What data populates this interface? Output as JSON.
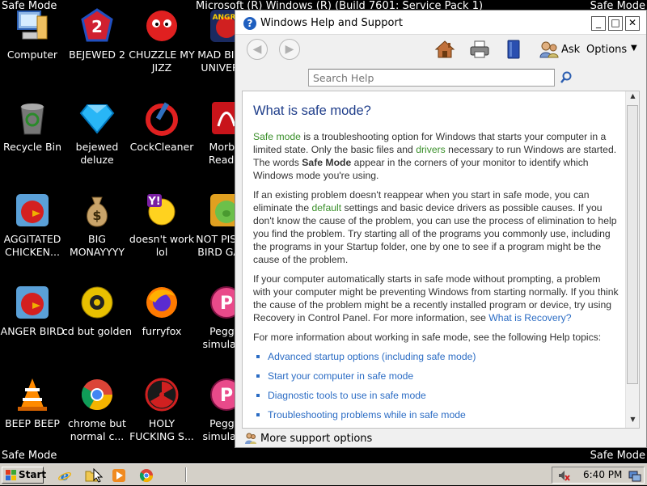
{
  "screen": {
    "mode_label_tl": "Safe Mode",
    "mode_label_tr": "Safe Mode",
    "mode_label_bl": "Safe Mode",
    "mode_label_br": "Safe Mode",
    "os_title": "Microsoft (R) Windows (R) (Build 7601: Service Pack 1)"
  },
  "desktop_icons": [
    {
      "label": "Computer",
      "icon": "computer-icon"
    },
    {
      "label": "BEJEWED 2",
      "icon": "bejewed2-icon"
    },
    {
      "label": "CHUZZLE MY JIZZ",
      "icon": "chuzzle-icon"
    },
    {
      "label": "MAD BIRDS UNIVERSE",
      "icon": "angry-birds-icon"
    },
    {
      "label": "Recycle Bin",
      "icon": "recycle-bin-icon"
    },
    {
      "label": "bejewed deluze",
      "icon": "diamond-icon"
    },
    {
      "label": "CockCleaner",
      "icon": "ccleaner-icon"
    },
    {
      "label": "Morbid Reader",
      "icon": "pdf-reader-icon"
    },
    {
      "label": "AGGITATED CHICKEN...",
      "icon": "angry-bird-red-icon"
    },
    {
      "label": "BIG MONAYYYY",
      "icon": "money-bag-icon"
    },
    {
      "label": "doesn't work lol",
      "icon": "yahoo-messenger-icon"
    },
    {
      "label": "NOT PISSED BIRD GAME",
      "icon": "pig-icon"
    },
    {
      "label": "ANGER BIRD",
      "icon": "angry-bird-red-icon"
    },
    {
      "label": "cd but golden",
      "icon": "golden-cd-icon"
    },
    {
      "label": "furryfox",
      "icon": "firefox-icon"
    },
    {
      "label": "Peggle simulator",
      "icon": "peggle-icon"
    },
    {
      "label": "BEEP BEEP",
      "icon": "vlc-cone-icon"
    },
    {
      "label": "chrome but normal c...",
      "icon": "chrome-icon"
    },
    {
      "label": "HOLY FUCKING S...",
      "icon": "radiation-icon"
    },
    {
      "label": "Peggle simulator",
      "icon": "peggle-icon"
    }
  ],
  "help_window": {
    "title": "Windows Help and Support",
    "controls": {
      "minimize": "_",
      "maximize": "□",
      "close": "✕"
    },
    "toolbar": {
      "ask": "Ask",
      "options": "Options"
    },
    "search": {
      "placeholder": "Search Help"
    },
    "article": {
      "heading": "What is safe mode?",
      "p1_link1": "Safe mode",
      "p1_text1": " is a troubleshooting option for Windows that starts your computer in a limited state. Only the basic files and ",
      "p1_link2": "drivers",
      "p1_text2": " necessary to run Windows are started. The words ",
      "p1_bold": "Safe Mode",
      "p1_text3": " appear in the corners of your monitor to identify which Windows mode you're using.",
      "p2_text1": "If an existing problem doesn't reappear when you start in safe mode, you can eliminate the ",
      "p2_link": "default",
      "p2_text2": " settings and basic device drivers as possible causes. If you don't know the cause of the problem, you can use the process of elimination to help you find the problem. Try starting all of the programs you commonly use, including the programs in your Startup folder, one by one to see if a program might be the cause of the problem.",
      "p3_text": "If your computer automatically starts in safe mode without prompting, a problem with your computer might be preventing Windows from starting normally. If you think the cause of the problem might be a recently installed program or device, try using Recovery in Control Panel. For more information, see ",
      "p3_link": "What is Recovery?",
      "p4_text": "For more information about working in safe mode, see the following Help topics:",
      "topics": [
        "Advanced startup options (including safe mode)",
        "Start your computer in safe mode",
        "Diagnostic tools to use in safe mode",
        "Troubleshooting problems while in safe mode"
      ]
    },
    "support_label": "More support options"
  },
  "taskbar": {
    "start_label": "Start",
    "time": "6:40 PM"
  },
  "colors": {
    "heading": "#1e3d8a",
    "link_blue": "#2b6cc4",
    "glossary_green": "#3a8f2a",
    "taskbar": "#d4d0c8"
  }
}
